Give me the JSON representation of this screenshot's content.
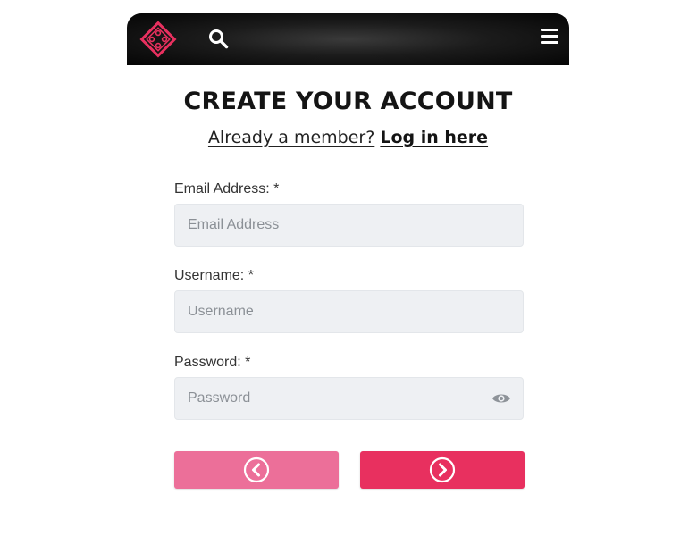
{
  "header": {
    "logo_icon": "pink-diamond-logo-icon",
    "search_icon": "search-icon",
    "menu_icon": "hamburger-menu-icon",
    "brand_color": "#e8305f"
  },
  "main": {
    "title": "CREATE YOUR ACCOUNT",
    "member_prompt": "Already a member?",
    "login_link": "Log in here"
  },
  "form": {
    "email": {
      "label": "Email Address: *",
      "placeholder": "Email Address",
      "value": ""
    },
    "username": {
      "label": "Username: *",
      "placeholder": "Username",
      "value": ""
    },
    "password": {
      "label": "Password: *",
      "placeholder": "Password",
      "value": "",
      "toggle_icon": "eye-icon"
    }
  },
  "buttons": {
    "back_icon": "chevron-left-circle-icon",
    "next_icon": "chevron-right-circle-icon",
    "back_color": "#ec6f99",
    "next_color": "#e8305f"
  }
}
